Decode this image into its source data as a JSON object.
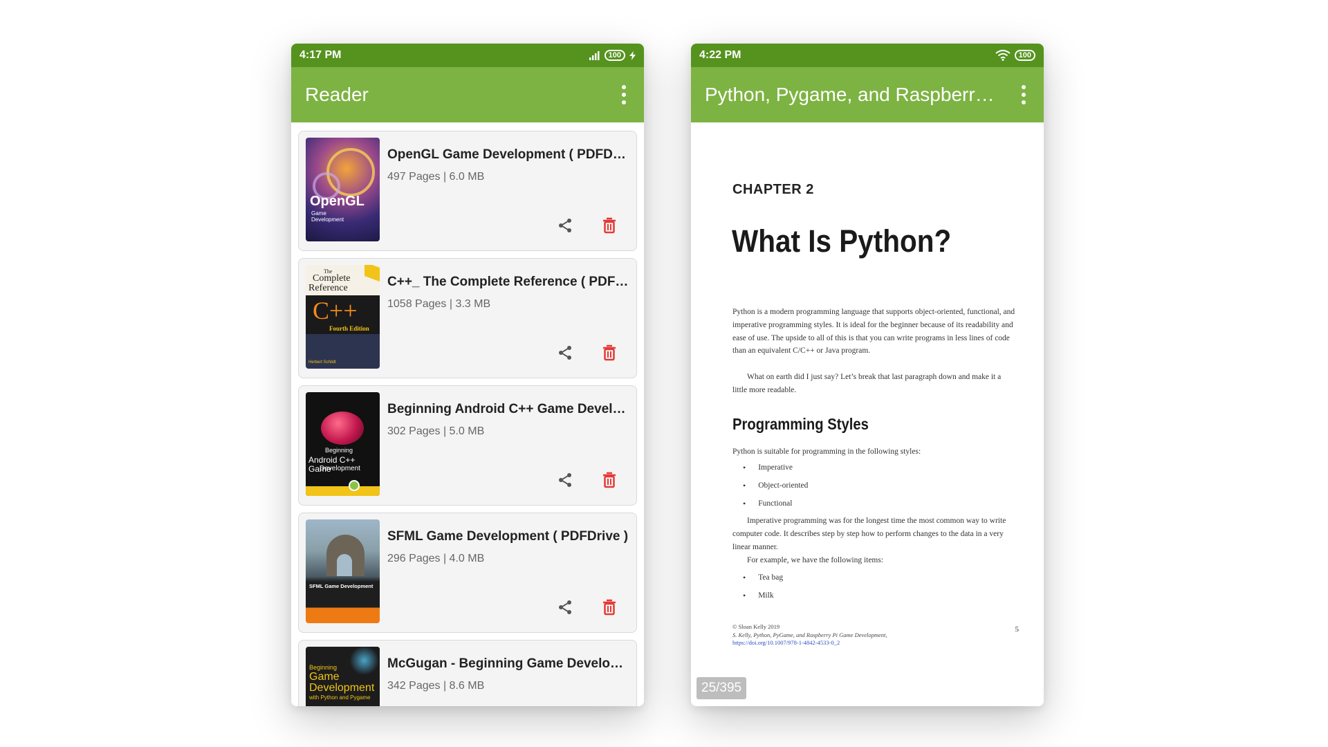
{
  "left_screen": {
    "status": {
      "time": "4:17 PM",
      "battery": "100"
    },
    "app_bar": {
      "title": "Reader"
    },
    "books": [
      {
        "title": "OpenGL Game Development ( PDFDri…",
        "meta": "497 Pages | 6.0 MB",
        "cover": "opengl",
        "cover_text": [
          "OpenGL",
          "Game",
          "Development"
        ]
      },
      {
        "title": "C++_ The Complete Reference ( PDF…",
        "meta": "1058 Pages | 3.3 MB",
        "cover": "cpp",
        "cover_text": [
          "The",
          "Complete",
          "Reference",
          "C++",
          "Fourth Edition",
          "Herbert Schildt"
        ]
      },
      {
        "title": "Beginning Android C++ Game Develo…",
        "meta": "302 Pages | 5.0 MB",
        "cover": "android",
        "cover_text": [
          "Beginning",
          "Android C++ Game",
          "Development"
        ]
      },
      {
        "title": "SFML Game Development ( PDFDrive )",
        "meta": "296 Pages | 4.0 MB",
        "cover": "sfml",
        "cover_text": [
          "SFML Game Development"
        ]
      },
      {
        "title": "McGugan - Beginning Game Develop…",
        "meta": "342 Pages | 8.6 MB",
        "cover": "game",
        "cover_text": [
          "Beginning",
          "Game",
          "Development",
          "with Python and Pygame"
        ]
      }
    ]
  },
  "right_screen": {
    "status": {
      "time": "4:22 PM",
      "battery": "100"
    },
    "app_bar": {
      "title": "Python, Pygame, and Raspberry…"
    },
    "page": {
      "chapter_label": "CHAPTER 2",
      "chapter_title": "What Is Python?",
      "paragraph1": "Python is a modern programming language that supports object-oriented, functional, and imperative programming styles. It is ideal for the beginner because of its readability and ease of use. The upside to all of this is that you can write programs in less lines of code than an equivalent C/C++ or Java program.",
      "paragraph2": "What on earth did I just say? Let’s break that last paragraph down and make it a little more readable.",
      "section_title": "Programming Styles",
      "section_intro": "Python is suitable for programming in the following styles:",
      "styles": [
        "Imperative",
        "Object-oriented",
        "Functional"
      ],
      "paragraph3": "Imperative programming was for the longest time the most common way to write computer code. It describes step by step how to perform changes to the data in a very linear manner.",
      "paragraph4": "For example, we have the following items:",
      "items": [
        "Tea bag",
        "Milk"
      ],
      "footer_copyright": "© Sloan Kelly 2019",
      "footer_citation": "S. Kelly, Python, PyGame, and Raspberry Pi Game Development,",
      "footer_doi": "https://doi.org/10.1007/978-1-4842-4533-0_2",
      "footer_page_number": "5",
      "page_counter": "25/395"
    }
  },
  "colors": {
    "status_bar": "#55931e",
    "app_bar": "#7cb342",
    "delete_icon": "#e53935",
    "share_icon": "#555555"
  }
}
